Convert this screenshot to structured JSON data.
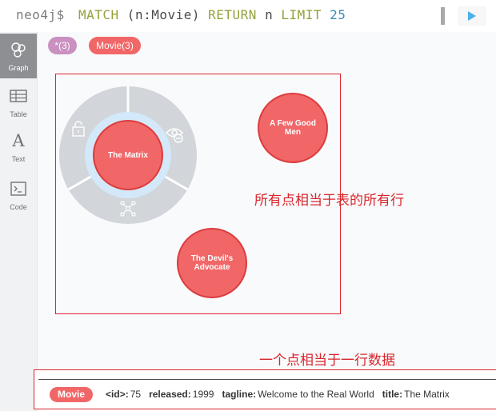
{
  "editor": {
    "prompt": "neo4j$",
    "query_match": "MATCH",
    "query_pattern": " (n:Movie) ",
    "query_return": "RETURN",
    "query_var": " n ",
    "query_limit": "LIMIT",
    "query_limit_value": " 25"
  },
  "sidebar": {
    "items": [
      {
        "label": "Graph",
        "icon": "graph-icon"
      },
      {
        "label": "Table",
        "icon": "table-icon"
      },
      {
        "label": "Text",
        "icon": "text-icon"
      },
      {
        "label": "Code",
        "icon": "code-icon"
      }
    ]
  },
  "labels": {
    "all": "*(3)",
    "movie": "Movie(3)"
  },
  "nodes": [
    {
      "name": "The Matrix"
    },
    {
      "name": "A Few Good Men"
    },
    {
      "name": "The Devil's Advocate"
    }
  ],
  "annotations": {
    "all_nodes": "所有点相当于表的所有行",
    "one_node": "一个点相当于一行数据"
  },
  "properties": {
    "label": "Movie",
    "id_key": "<id>:",
    "id_value": "75",
    "released_key": "released:",
    "released_value": "1999",
    "tagline_key": "tagline:",
    "tagline_value": "Welcome to the Real World",
    "title_key": "title:",
    "title_value": "The Matrix"
  },
  "colors": {
    "movie": "#f16667",
    "all": "#c990c0",
    "annotation": "#d9262d"
  }
}
